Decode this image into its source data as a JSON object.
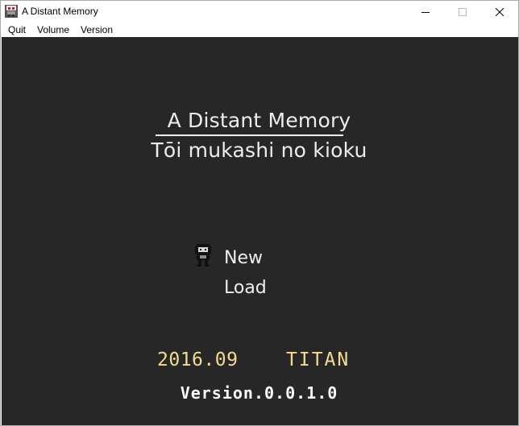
{
  "window": {
    "title": "A Distant Memory",
    "icon": "app-icon",
    "controls": [
      "minimize-icon",
      "maximize-icon",
      "close-icon"
    ]
  },
  "menubar": {
    "items": [
      {
        "label": "Quit"
      },
      {
        "label": "Volume"
      },
      {
        "label": "Version"
      }
    ]
  },
  "game": {
    "title_en": "A Distant Memory",
    "title_jp": "Tōi mukashi no kioku",
    "cursor_icon": "character-sprite-icon",
    "options": [
      {
        "label": "New"
      },
      {
        "label": "Load"
      }
    ],
    "date": "2016.09",
    "author": "TITAN",
    "version": "Version.0.0.1.0"
  },
  "colors": {
    "background": "#272727",
    "text": "#ededed",
    "accent": "#f3dc8e"
  }
}
